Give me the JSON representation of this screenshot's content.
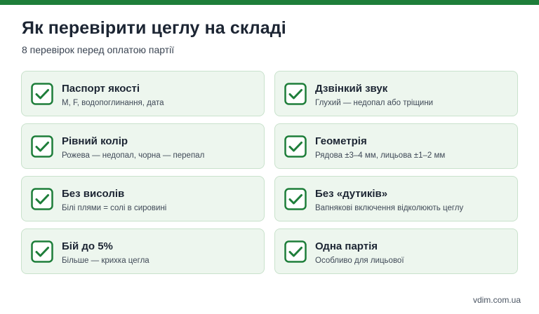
{
  "colors": {
    "accent": "#1e7e3a",
    "card_bg": "#edf6ee",
    "card_border": "#c9e2cc"
  },
  "header": {
    "title": "Як перевірити цеглу на складі",
    "subtitle": "8 перевірок перед оплатою партії"
  },
  "checks": [
    {
      "icon": "checkbox-checked-icon",
      "title": "Паспорт якості",
      "desc": "М, F, водопоглинання, дата"
    },
    {
      "icon": "checkbox-checked-icon",
      "title": "Дзвінкий звук",
      "desc": "Глухий — недопал або тріщини"
    },
    {
      "icon": "checkbox-checked-icon",
      "title": "Рівний колір",
      "desc": "Рожева — недопал, чорна — перепал"
    },
    {
      "icon": "checkbox-checked-icon",
      "title": "Геометрія",
      "desc": "Рядова ±3–4 мм, лицьова ±1–2 мм"
    },
    {
      "icon": "checkbox-checked-icon",
      "title": "Без висолів",
      "desc": "Білі плями = солі в сировині"
    },
    {
      "icon": "checkbox-checked-icon",
      "title": "Без «дутиків»",
      "desc": "Вапнякові включення відколюють цеглу"
    },
    {
      "icon": "checkbox-checked-icon",
      "title": "Бій до 5%",
      "desc": "Більше — крихка цегла"
    },
    {
      "icon": "checkbox-checked-icon",
      "title": "Одна партія",
      "desc": "Особливо для лицьової"
    }
  ],
  "footer": {
    "site": "vdim.com.ua"
  }
}
